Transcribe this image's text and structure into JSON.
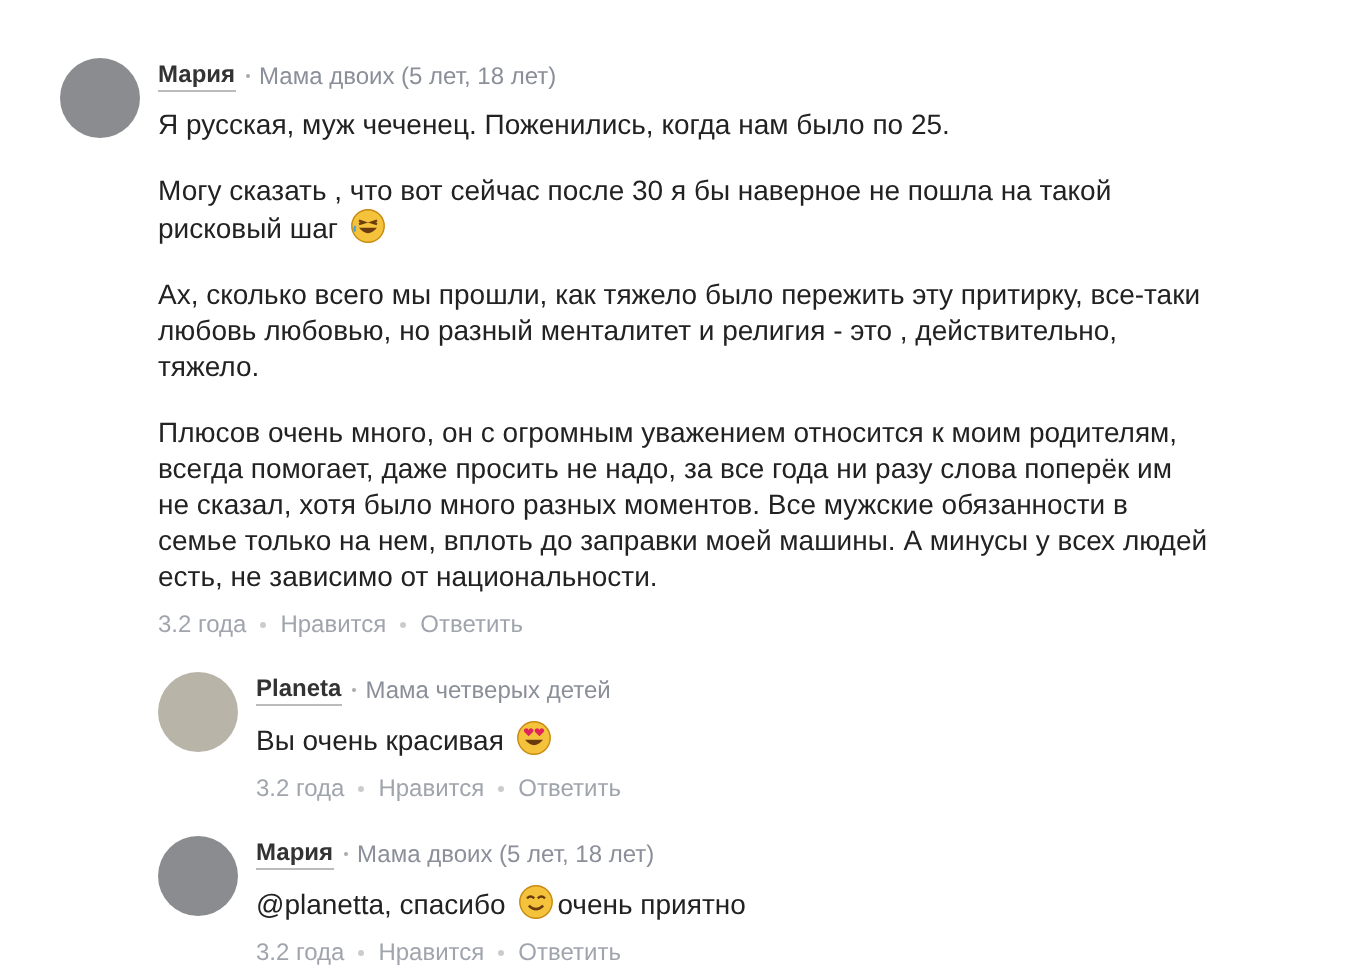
{
  "comment": {
    "author": "Мария",
    "badge": "Мама двоих (5 лет, 18 лет)",
    "paragraphs": [
      [
        {
          "kind": "text",
          "text": "Я русская, муж чеченец. Поженились, когда нам было по 25."
        }
      ],
      [
        {
          "kind": "text",
          "text": "Могу сказать , что вот сейчас после 30 я бы наверное не пошла на такой рисковый шаг"
        },
        {
          "kind": "laughing"
        }
      ],
      [
        {
          "kind": "text",
          "text": "Ах, сколько всего мы прошли, как тяжело было пережить эту притирку, все-таки любовь любовью, но разный менталитет и религия - это , действительно, тяжело."
        }
      ],
      [
        {
          "kind": "text",
          "text": "Плюсов очень много, он с огромным уважением относится к моим родителям, всегда помогает, даже просить не надо, за все года ни разу слова поперёк им не сказал, хотя было много разных моментов. Все мужские обязанности в семье только на нем, вплоть до заправки моей машины. А минусы у всех людей есть, не зависимо от национальности."
        }
      ]
    ],
    "footer": [
      "3.2 года",
      "Нравится",
      "Ответить"
    ],
    "replies": [
      {
        "author": "Planeta",
        "badge": "Мама четверых детей",
        "paragraphs": [
          [
            {
              "kind": "text",
              "text": "Вы очень красивая"
            },
            {
              "kind": "hearteyes"
            }
          ]
        ],
        "footer": [
          "3.2 года",
          "Нравится",
          "Ответить"
        ]
      },
      {
        "author": "Мария",
        "badge": "Мама двоих (5 лет, 18 лет)",
        "paragraphs": [
          [
            {
              "kind": "text",
              "text": "@planetta, спасибо"
            },
            {
              "kind": "smiling"
            },
            {
              "kind": "text",
              "text": "очень приятно"
            }
          ]
        ],
        "footer": [
          "3.2 года",
          "Нравится",
          "Ответить"
        ]
      }
    ]
  }
}
